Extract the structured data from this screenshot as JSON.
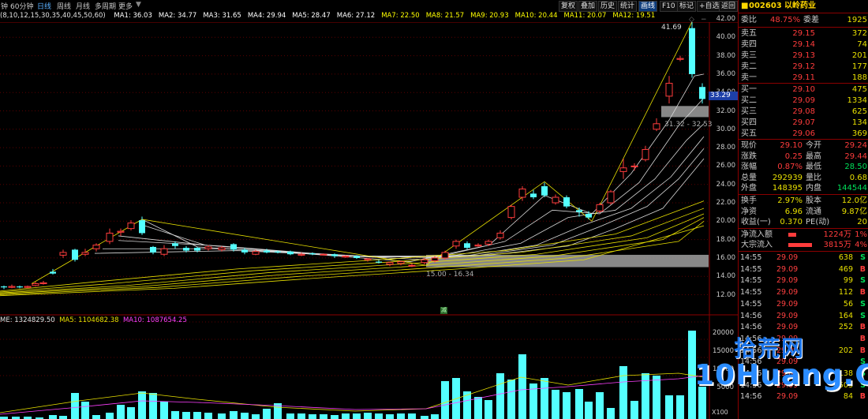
{
  "toolbar": {
    "items": [
      "钟",
      "60分钟",
      "日线",
      "周线",
      "月线",
      "多周期",
      "更多"
    ],
    "active": "日线",
    "right_buttons": [
      "复权",
      "叠加",
      "历史",
      "统计",
      "画线",
      "F10",
      "标记",
      "+自选",
      "返回"
    ],
    "right_active": "画线"
  },
  "ma_params": "(8,10,12,15,30,35,40,45,50,60)",
  "ma_values": [
    {
      "label": "MA1: 36.03",
      "color": "#ffffff"
    },
    {
      "label": "MA2: 34.77",
      "color": "#ffffff"
    },
    {
      "label": "MA3: 31.65",
      "color": "#ffffff"
    },
    {
      "label": "MA4: 29.94",
      "color": "#ffffff"
    },
    {
      "label": "MA5: 28.47",
      "color": "#ffffff"
    },
    {
      "label": "MA6: 27.12",
      "color": "#ffffff"
    },
    {
      "label": "MA7: 22.50",
      "color": "#ffff00"
    },
    {
      "label": "MA8: 21.57",
      "color": "#ffff00"
    },
    {
      "label": "MA9: 20.93",
      "color": "#ffff00"
    },
    {
      "label": "MA10: 20.44",
      "color": "#ffff00"
    },
    {
      "label": "MA11: 20.07",
      "color": "#ffff00"
    },
    {
      "label": "MA12: 19.51",
      "color": "#ffff00"
    }
  ],
  "price_axis": [
    "42.00",
    "40.00",
    "38.00",
    "36.00",
    "34.00",
    "32.00",
    "30.00",
    "28.00",
    "26.00",
    "24.00",
    "22.00",
    "20.00",
    "18.00",
    "16.00",
    "14.00",
    "12.00"
  ],
  "current_price_tag": "33.29",
  "high_label": "41.69",
  "zone_upper_label": "31.32 - 32.53",
  "zone_lower_label": "15.00 - 16.34",
  "volume_labels": {
    "vol": "ME: 1324829.50",
    "ma5": "MA5: 1104682.38",
    "ma10": "MA10: 1087654.25",
    "axis": [
      "20000",
      "15000",
      "10000",
      "5000"
    ],
    "unit": "X100"
  },
  "quote": {
    "code": "002603",
    "name": "以岭药业",
    "weibi_label": "委比",
    "weibi": "48.75%",
    "weicha_label": "委差",
    "weicha": "1925",
    "asks": [
      {
        "label": "卖五",
        "price": "29.15",
        "vol": "372"
      },
      {
        "label": "卖四",
        "price": "29.14",
        "vol": "74"
      },
      {
        "label": "卖三",
        "price": "29.13",
        "vol": "201"
      },
      {
        "label": "卖二",
        "price": "29.12",
        "vol": "177"
      },
      {
        "label": "卖一",
        "price": "29.11",
        "vol": "188"
      }
    ],
    "bids": [
      {
        "label": "买一",
        "price": "29.10",
        "vol": "475"
      },
      {
        "label": "买二",
        "price": "29.09",
        "vol": "1334"
      },
      {
        "label": "买三",
        "price": "29.08",
        "vol": "625"
      },
      {
        "label": "买四",
        "price": "29.07",
        "vol": "134"
      },
      {
        "label": "买五",
        "price": "29.06",
        "vol": "369"
      }
    ],
    "stats": [
      {
        "l1": "现价",
        "v1": "29.10",
        "l2": "今开",
        "v2": "29.24"
      },
      {
        "l1": "涨跌",
        "v1": "0.25",
        "l2": "最高",
        "v2": "29.44"
      },
      {
        "l1": "涨幅",
        "v1": "0.87%",
        "l2": "最低",
        "v2": "28.50"
      },
      {
        "l1": "总量",
        "v1": "292939",
        "l2": "量比",
        "v2": "0.68"
      },
      {
        "l1": "外盘",
        "v1": "148395",
        "l2": "内盘",
        "v2": "144544"
      }
    ],
    "stats2": [
      {
        "l1": "换手",
        "v1": "2.97%",
        "l2": "股本",
        "v2": "12.0亿"
      },
      {
        "l1": "净资",
        "v1": "6.96",
        "l2": "流通",
        "v2": "9.87亿"
      },
      {
        "l1": "收益(一)",
        "v1": "0.370",
        "l2": "PE(动)",
        "v2": "20"
      }
    ],
    "flows": [
      {
        "label": "净流入额",
        "value": "1224万",
        "pct": "1%"
      },
      {
        "label": "大宗流入",
        "value": "3815万",
        "pct": "4%"
      }
    ]
  },
  "ticks": [
    {
      "t": "14:55",
      "p": "29.09",
      "v": "638",
      "s": "S"
    },
    {
      "t": "14:55",
      "p": "29.09",
      "v": "469",
      "s": "B"
    },
    {
      "t": "14:55",
      "p": "29.09",
      "v": "99",
      "s": "S"
    },
    {
      "t": "14:55",
      "p": "29.09",
      "v": "112",
      "s": "B"
    },
    {
      "t": "14:55",
      "p": "29.09",
      "v": "56",
      "s": "S"
    },
    {
      "t": "14:56",
      "p": "29.09",
      "v": "164",
      "s": "S"
    },
    {
      "t": "14:56",
      "p": "29.09",
      "v": "252",
      "s": "B"
    },
    {
      "t": "14:56",
      "p": "29.09",
      "v": "",
      "s": "B"
    },
    {
      "t": "14:56",
      "p": "29.09",
      "v": "202",
      "s": "B"
    },
    {
      "t": "14:56",
      "p": "29.09",
      "v": "",
      "s": "S"
    },
    {
      "t": "14:56",
      "p": "29.09",
      "v": "138",
      "s": "S"
    },
    {
      "t": "14:56",
      "p": "29.09",
      "v": "503",
      "s": "S"
    },
    {
      "t": "14:56",
      "p": "29.09",
      "v": "84",
      "s": "B"
    }
  ],
  "watermark": {
    "line1": "拾荒网",
    "line2": "10Huang.CN"
  },
  "colors": {
    "up": "#ff3c3c",
    "down": "#54ffff",
    "yellow": "#e8e000",
    "panel_border": "#8b0000"
  }
}
